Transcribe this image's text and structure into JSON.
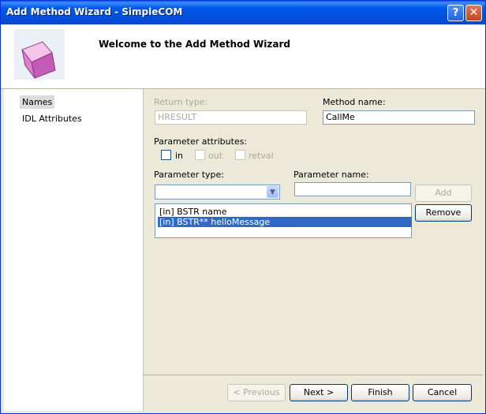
{
  "window": {
    "title": "Add Method Wizard - SimpleCOM",
    "help_label": "?",
    "close_label": "✕"
  },
  "header": {
    "title": "Welcome to the Add Method Wizard"
  },
  "nav": {
    "items": [
      {
        "label": "Names"
      },
      {
        "label": "IDL Attributes"
      }
    ]
  },
  "form": {
    "return_type_label": "Return type:",
    "return_type_value": "HRESULT",
    "method_name_label": "Method name:",
    "method_name_value": "CallMe",
    "param_attributes_label": "Parameter attributes:",
    "attr_in": "in",
    "attr_out": "out",
    "attr_retval": "retval",
    "param_type_label": "Parameter type:",
    "param_type_value": "",
    "param_name_label": "Parameter name:",
    "param_name_value": "",
    "add_label": "Add",
    "remove_label": "Remove",
    "parameters": [
      "[in] BSTR name",
      "[in] BSTR** helloMessage"
    ]
  },
  "footer": {
    "previous_label": "< Previous",
    "next_label": "Next >",
    "finish_label": "Finish",
    "cancel_label": "Cancel"
  },
  "colors": {
    "titlebar": "#0058EE",
    "selection": "#316AC5",
    "dialog_bg": "#ECE9D8"
  }
}
